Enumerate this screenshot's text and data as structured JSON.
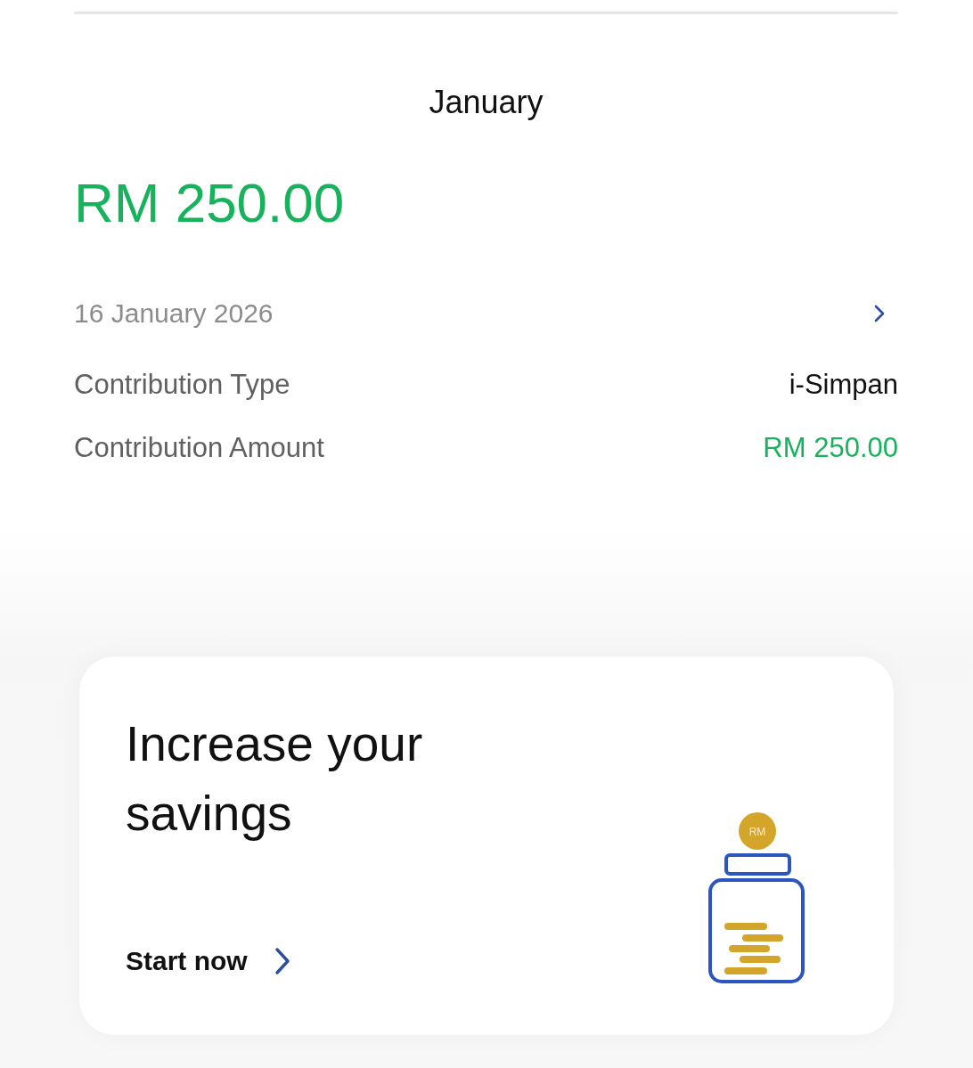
{
  "header": {
    "title": "January"
  },
  "transaction": {
    "amount": "RM 250.00",
    "date": "16 January 2026",
    "details": [
      {
        "label": "Contribution Type",
        "value": "i-Simpan",
        "kind": "plain"
      },
      {
        "label": "Contribution Amount",
        "value": "RM 250.00",
        "kind": "amount"
      }
    ]
  },
  "promo_card": {
    "title": "Increase your savings",
    "action": "Start now",
    "coin_label": "RM"
  }
}
